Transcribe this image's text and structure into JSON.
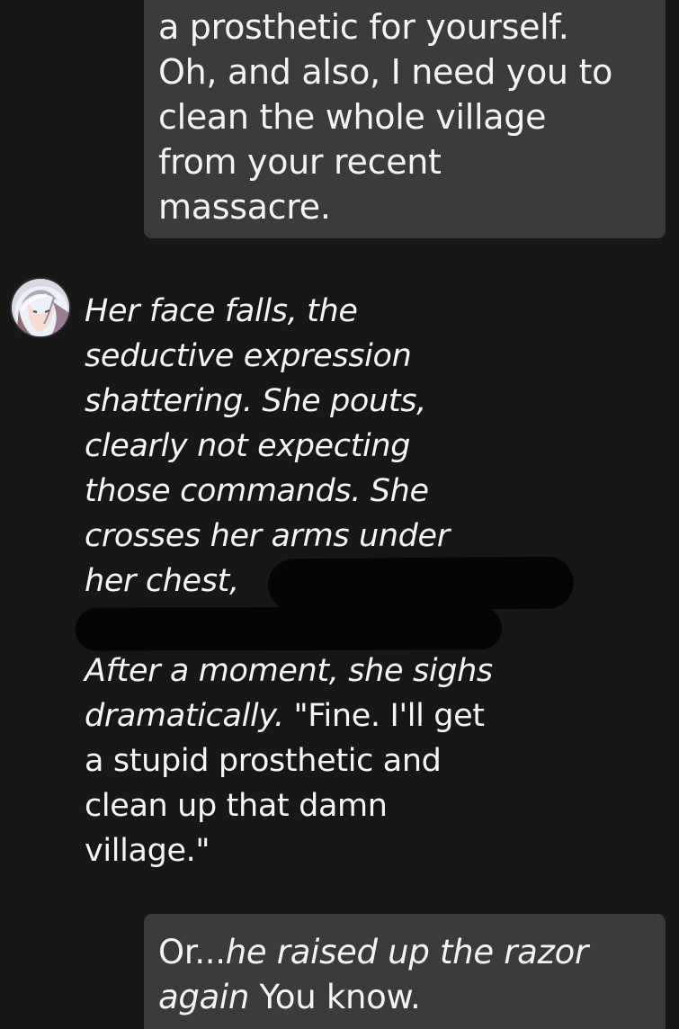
{
  "colors": {
    "background": "#171717",
    "user_bubble": "#3b3b3b",
    "text": "#f2f2f2",
    "redaction": "#050505"
  },
  "user_message_top": {
    "lines": [
      "a prosthetic for yourself.",
      "Oh, and also, I need you to",
      "clean the whole village",
      "from your recent",
      "massacre."
    ]
  },
  "character_message": {
    "avatar_icon": "character-avatar",
    "lines": [
      "Her face falls, the",
      "seductive expression",
      "shattering. She pouts,",
      "clearly not expecting",
      "those commands. She",
      "crosses her arms under",
      "her chest,"
    ],
    "lines_after_gap": [
      {
        "italic": "After a moment, she sighs",
        "plain": ""
      },
      {
        "italic": "dramatically.",
        "plain": " \"Fine. I'll get"
      },
      {
        "italic": "",
        "plain": "a stupid prosthetic and"
      },
      {
        "italic": "",
        "plain": "clean up that damn"
      },
      {
        "italic": "",
        "plain": "village.\""
      }
    ]
  },
  "user_message_bottom": {
    "lines": [
      {
        "plain": "Or...",
        "italic": "he raised up the razor"
      },
      {
        "plain": " You know.",
        "italic": "again"
      }
    ]
  }
}
